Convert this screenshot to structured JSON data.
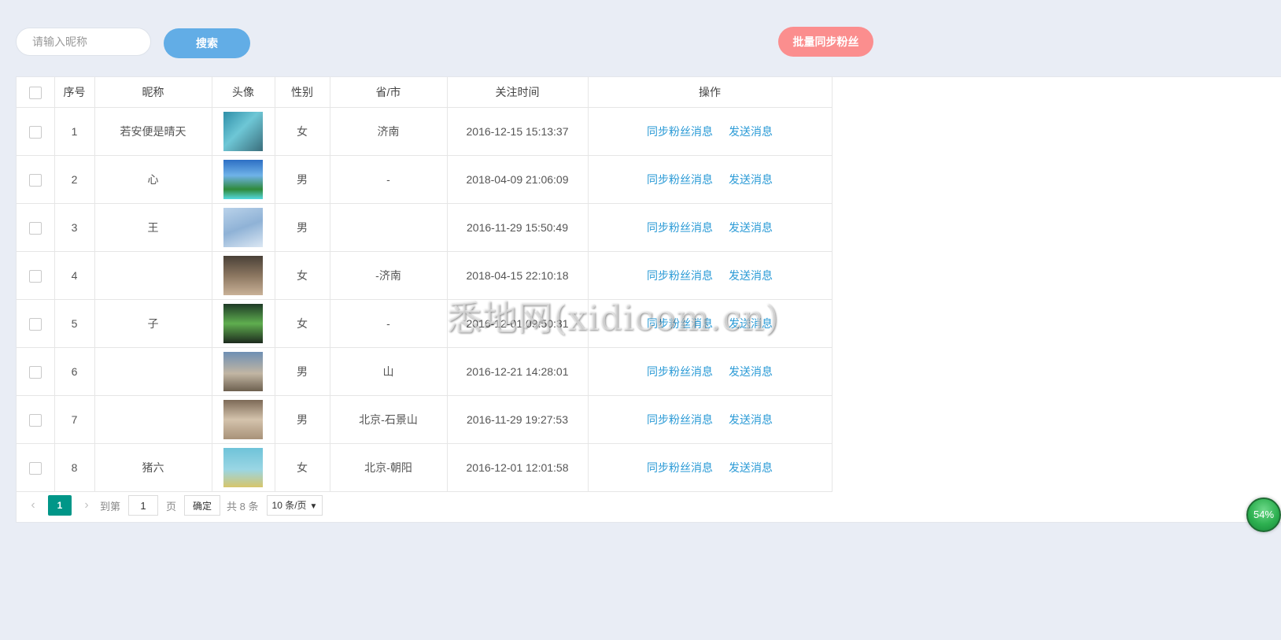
{
  "toolbar": {
    "search_placeholder": "请输入昵称",
    "search_label": "搜索",
    "sync_all_label": "批量同步粉丝"
  },
  "table": {
    "headers": {
      "index": "序号",
      "nickname": "昵称",
      "avatar": "头像",
      "gender": "性别",
      "region": "省/市",
      "follow_time": "关注时间",
      "actions": "操作"
    },
    "rows": [
      {
        "index": "1",
        "nickname": "若安便是晴天",
        "gender": "女",
        "region": "济南",
        "follow_time": "2016-12-15 15:13:37",
        "sync": "同步粉丝消息",
        "send": "发送消息"
      },
      {
        "index": "2",
        "nickname": "心",
        "gender": "男",
        "region": "-",
        "follow_time": "2018-04-09 21:06:09",
        "sync": "同步粉丝消息",
        "send": "发送消息"
      },
      {
        "index": "3",
        "nickname": "王",
        "gender": "男",
        "region": "",
        "follow_time": "2016-11-29 15:50:49",
        "sync": "同步粉丝消息",
        "send": "发送消息"
      },
      {
        "index": "4",
        "nickname": "",
        "gender": "女",
        "region": "-济南",
        "follow_time": "2018-04-15 22:10:18",
        "sync": "同步粉丝消息",
        "send": "发送消息"
      },
      {
        "index": "5",
        "nickname": "子",
        "gender": "女",
        "region": "-",
        "follow_time": "2016-12-01 09:50:31",
        "sync": "同步粉丝消息",
        "send": "发送消息"
      },
      {
        "index": "6",
        "nickname": "",
        "gender": "男",
        "region": "山",
        "follow_time": "2016-12-21 14:28:01",
        "sync": "同步粉丝消息",
        "send": "发送消息"
      },
      {
        "index": "7",
        "nickname": "",
        "gender": "男",
        "region": "北京-石景山",
        "follow_time": "2016-11-29 19:27:53",
        "sync": "同步粉丝消息",
        "send": "发送消息"
      },
      {
        "index": "8",
        "nickname": "猪六",
        "gender": "女",
        "region": "北京-朝阳",
        "follow_time": "2016-12-01 12:01:58",
        "sync": "同步粉丝消息",
        "send": "发送消息"
      }
    ]
  },
  "pagination": {
    "prev_icon": "‹",
    "next_icon": "›",
    "current_page": "1",
    "goto_label": "到第",
    "goto_value": "1",
    "page_unit": "页",
    "confirm_label": "确定",
    "total_label": "共 8 条",
    "page_size_label": "10 条/页",
    "page_size_caret": "▼"
  },
  "watermark": "悉地网(xidicom.cn)",
  "progress_ball": "54%"
}
